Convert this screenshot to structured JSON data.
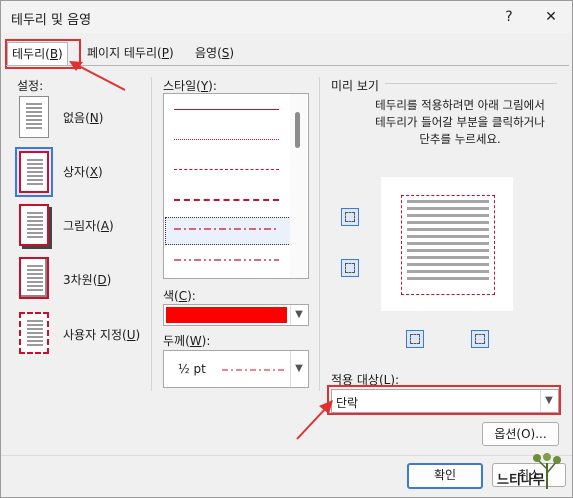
{
  "window": {
    "title": "테두리 및 음영",
    "help": "?",
    "close": "✕"
  },
  "tabs": [
    {
      "label": "테두리(",
      "key": "B",
      "suffix": ")"
    },
    {
      "label": "페이지 테두리(",
      "key": "P",
      "suffix": ")"
    },
    {
      "label": "음영(",
      "key": "S",
      "suffix": ")"
    }
  ],
  "settings": {
    "heading": "설정:",
    "items": [
      {
        "label": "없음(",
        "key": "N",
        "suffix": ")"
      },
      {
        "label": "상자(",
        "key": "X",
        "suffix": ")"
      },
      {
        "label": "그림자(",
        "key": "A",
        "suffix": ")"
      },
      {
        "label": "3차원(",
        "key": "D",
        "suffix": ")"
      },
      {
        "label": "사용자 지정(",
        "key": "U",
        "suffix": ")"
      }
    ]
  },
  "style": {
    "heading": "스타일(",
    "key": "Y",
    "suffix": "):"
  },
  "color": {
    "heading": "색(",
    "key": "C",
    "suffix": "):",
    "value_color": "#ff0000"
  },
  "width": {
    "heading": "두께(",
    "key": "W",
    "suffix": "):",
    "value": "½ pt"
  },
  "preview": {
    "heading": "미리 보기",
    "instruction": "테두리를 적용하려면 아래 그림에서 테두리가 들어갈 부분을 클릭하거나 단추를 누르세요."
  },
  "apply_to": {
    "heading": "적용 대상(",
    "key": "L",
    "suffix": "):",
    "value": "단락"
  },
  "buttons": {
    "options": "옵션(O)...",
    "ok": "확인",
    "cancel": "취소"
  },
  "watermark": {
    "text": "느티나무"
  },
  "colors": {
    "accent_red": "#e03030",
    "border_red": "#c8102e",
    "focus_blue": "#3d7ad6"
  }
}
